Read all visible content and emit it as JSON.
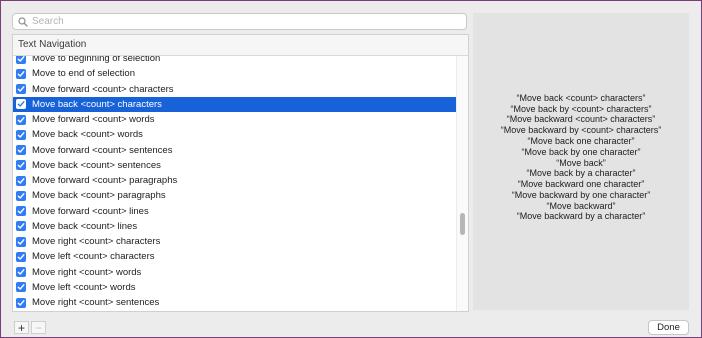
{
  "search": {
    "placeholder": "Search",
    "value": ""
  },
  "list": {
    "header": "Text Navigation",
    "items": [
      {
        "label": "Move to beginning of selection",
        "checked": true,
        "selected": false
      },
      {
        "label": "Move to end of selection",
        "checked": true,
        "selected": false
      },
      {
        "label": "Move forward <count> characters",
        "checked": true,
        "selected": false
      },
      {
        "label": "Move back <count> characters",
        "checked": true,
        "selected": true
      },
      {
        "label": "Move forward <count> words",
        "checked": true,
        "selected": false
      },
      {
        "label": "Move back <count> words",
        "checked": true,
        "selected": false
      },
      {
        "label": "Move forward <count> sentences",
        "checked": true,
        "selected": false
      },
      {
        "label": "Move back <count> sentences",
        "checked": true,
        "selected": false
      },
      {
        "label": "Move forward <count> paragraphs",
        "checked": true,
        "selected": false
      },
      {
        "label": "Move back <count> paragraphs",
        "checked": true,
        "selected": false
      },
      {
        "label": "Move forward <count> lines",
        "checked": true,
        "selected": false
      },
      {
        "label": "Move back <count> lines",
        "checked": true,
        "selected": false
      },
      {
        "label": "Move right <count> characters",
        "checked": true,
        "selected": false
      },
      {
        "label": "Move left <count> characters",
        "checked": true,
        "selected": false
      },
      {
        "label": "Move right <count> words",
        "checked": true,
        "selected": false
      },
      {
        "label": "Move left <count> words",
        "checked": true,
        "selected": false
      },
      {
        "label": "Move right <count> sentences",
        "checked": true,
        "selected": false
      }
    ]
  },
  "phrases": [
    "“Move back <count> characters”",
    "“Move back by <count> characters”",
    "“Move backward <count> characters”",
    "“Move backward by <count> characters”",
    "“Move back one character”",
    "“Move back by one character”",
    "“Move back”",
    "“Move back by a character”",
    "“Move backward one character”",
    "“Move backward by one character”",
    "“Move backward”",
    "“Move backward by a character”"
  ],
  "buttons": {
    "add": "+",
    "remove": "−",
    "done": "Done"
  },
  "colors": {
    "selection": "#1862d9",
    "checkbox": "#2f7cf6",
    "window_border": "#7a3d7a"
  }
}
